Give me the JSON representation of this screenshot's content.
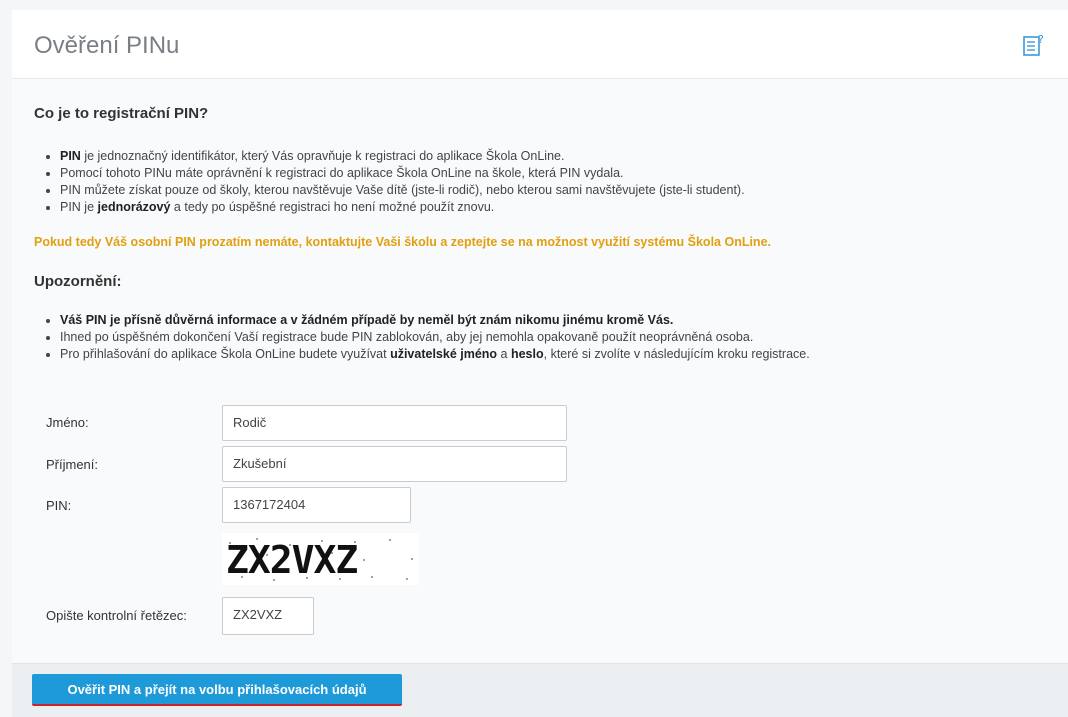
{
  "header": {
    "title": "Ověření PINu",
    "help_icon": "help-list-icon"
  },
  "section1": {
    "heading": "Co je to registrační PIN?",
    "items": [
      {
        "b1": "PIN",
        "t1": " je jednoznačný identifikátor, který Vás opravňuje k registraci do aplikace Škola OnLine."
      },
      {
        "t1": "Pomocí tohoto PINu máte oprávnění k registraci do aplikace Škola OnLine na škole, která PIN vydala."
      },
      {
        "t1": "PIN můžete získat pouze od školy, kterou navštěvuje Vaše dítě (jste-li rodič), nebo kterou sami navštěvujete (jste-li student)."
      },
      {
        "t1": "PIN je ",
        "b1": "jednorázový",
        "t2": " a tedy po úspěšné registraci ho není možné použít znovu."
      }
    ],
    "highlight": "Pokud tedy Váš osobní PIN prozatím nemáte, kontaktujte Vaši školu a zeptejte se na možnost využití systému Škola OnLine."
  },
  "section2": {
    "heading": "Upozornění:",
    "items": [
      {
        "b1": "Váš PIN je přísně důvěrná informace a v žádném případě by neměl být znám nikomu jinému kromě Vás."
      },
      {
        "t1": "Ihned po úspěšném dokončení Vaší registrace bude PIN zablokován, aby jej nemohla opakovaně použít neoprávněná osoba."
      },
      {
        "t1": "Pro přihlašování do aplikace Škola OnLine budete využívat ",
        "b1": "uživatelské jméno",
        "t2": " a ",
        "b2": "heslo",
        "t3": ", které si zvolíte v následujícím kroku registrace."
      }
    ]
  },
  "form": {
    "name_label": "Jméno:",
    "name_value": "Rodič",
    "surname_label": "Příjmení:",
    "surname_value": "Zkušební",
    "pin_label": "PIN:",
    "pin_value": "1367172404",
    "captcha_text": "ZX2VXZ",
    "captcha_label": "Opište kontrolní řetězec:",
    "captcha_value": "ZX2VXZ"
  },
  "submit_label": "Ověřit PIN a přejít na volbu přihlašovacích údajů"
}
